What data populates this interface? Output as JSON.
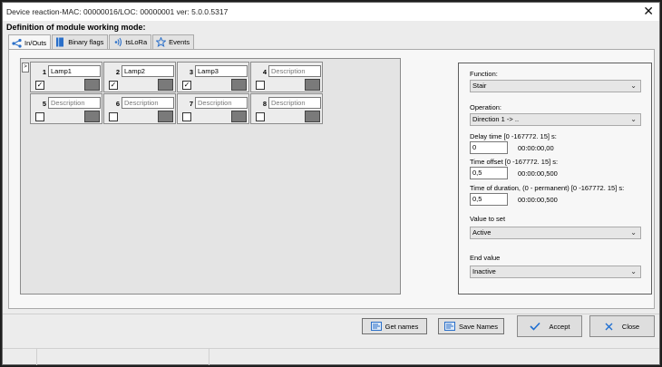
{
  "window": {
    "title": "Device reaction-MAC: 00000016/LOC: 00000001 ver: 5.0.0.5317",
    "close_glyph": "✕"
  },
  "heading": "Definition of module working mode:",
  "tabs": [
    {
      "label": "In/Outs",
      "icon": "share-icon",
      "active": true
    },
    {
      "label": "Binary flags",
      "icon": "flag-icon",
      "active": false
    },
    {
      "label": "tsLoRa",
      "icon": "signal-icon",
      "active": false
    },
    {
      "label": "Events",
      "icon": "star-icon",
      "active": false
    }
  ],
  "io_grid": {
    "side_arrow": ">",
    "cells": [
      {
        "num": "1",
        "label": "Lamp1",
        "placeholder": false,
        "checked": true
      },
      {
        "num": "2",
        "label": "Lamp2",
        "placeholder": false,
        "checked": true
      },
      {
        "num": "3",
        "label": "Lamp3",
        "placeholder": false,
        "checked": true
      },
      {
        "num": "4",
        "label": "Description",
        "placeholder": true,
        "checked": false
      },
      {
        "num": "5",
        "label": "Description",
        "placeholder": true,
        "checked": false
      },
      {
        "num": "6",
        "label": "Description",
        "placeholder": true,
        "checked": false
      },
      {
        "num": "7",
        "label": "Description",
        "placeholder": true,
        "checked": false
      },
      {
        "num": "8",
        "label": "Description",
        "placeholder": true,
        "checked": false
      }
    ]
  },
  "function_panel": {
    "function_label": "Function:",
    "function_value": "Stair",
    "operation_label": "Operation:",
    "operation_value": "Direction 1 ->  ..",
    "delay_label": "Delay time [0 -167772. 15] s:",
    "delay_value": "0",
    "delay_time": "00:00:00,00",
    "offset_label": "Time offset [0 -167772. 15] s:",
    "offset_value": "0,5",
    "offset_time": "00:00:00,500",
    "duration_label": "Time of duration, (0 - permanent) [0 -167772. 15] s:",
    "duration_value": "0,5",
    "duration_time": "00:00:00,500",
    "value_to_set_label": "Value to set",
    "value_to_set": "Active",
    "end_value_label": "End value",
    "end_value": "Inactive",
    "dropdown_glyph": "⌄"
  },
  "buttons": {
    "get_names": "Get names",
    "save_names": "Save Names",
    "accept": "Accept",
    "close": "Close"
  },
  "colors": {
    "accept_check": "#1f6fd1",
    "close_x": "#1f6fd1",
    "tab_icon": "#2a6fc9"
  }
}
